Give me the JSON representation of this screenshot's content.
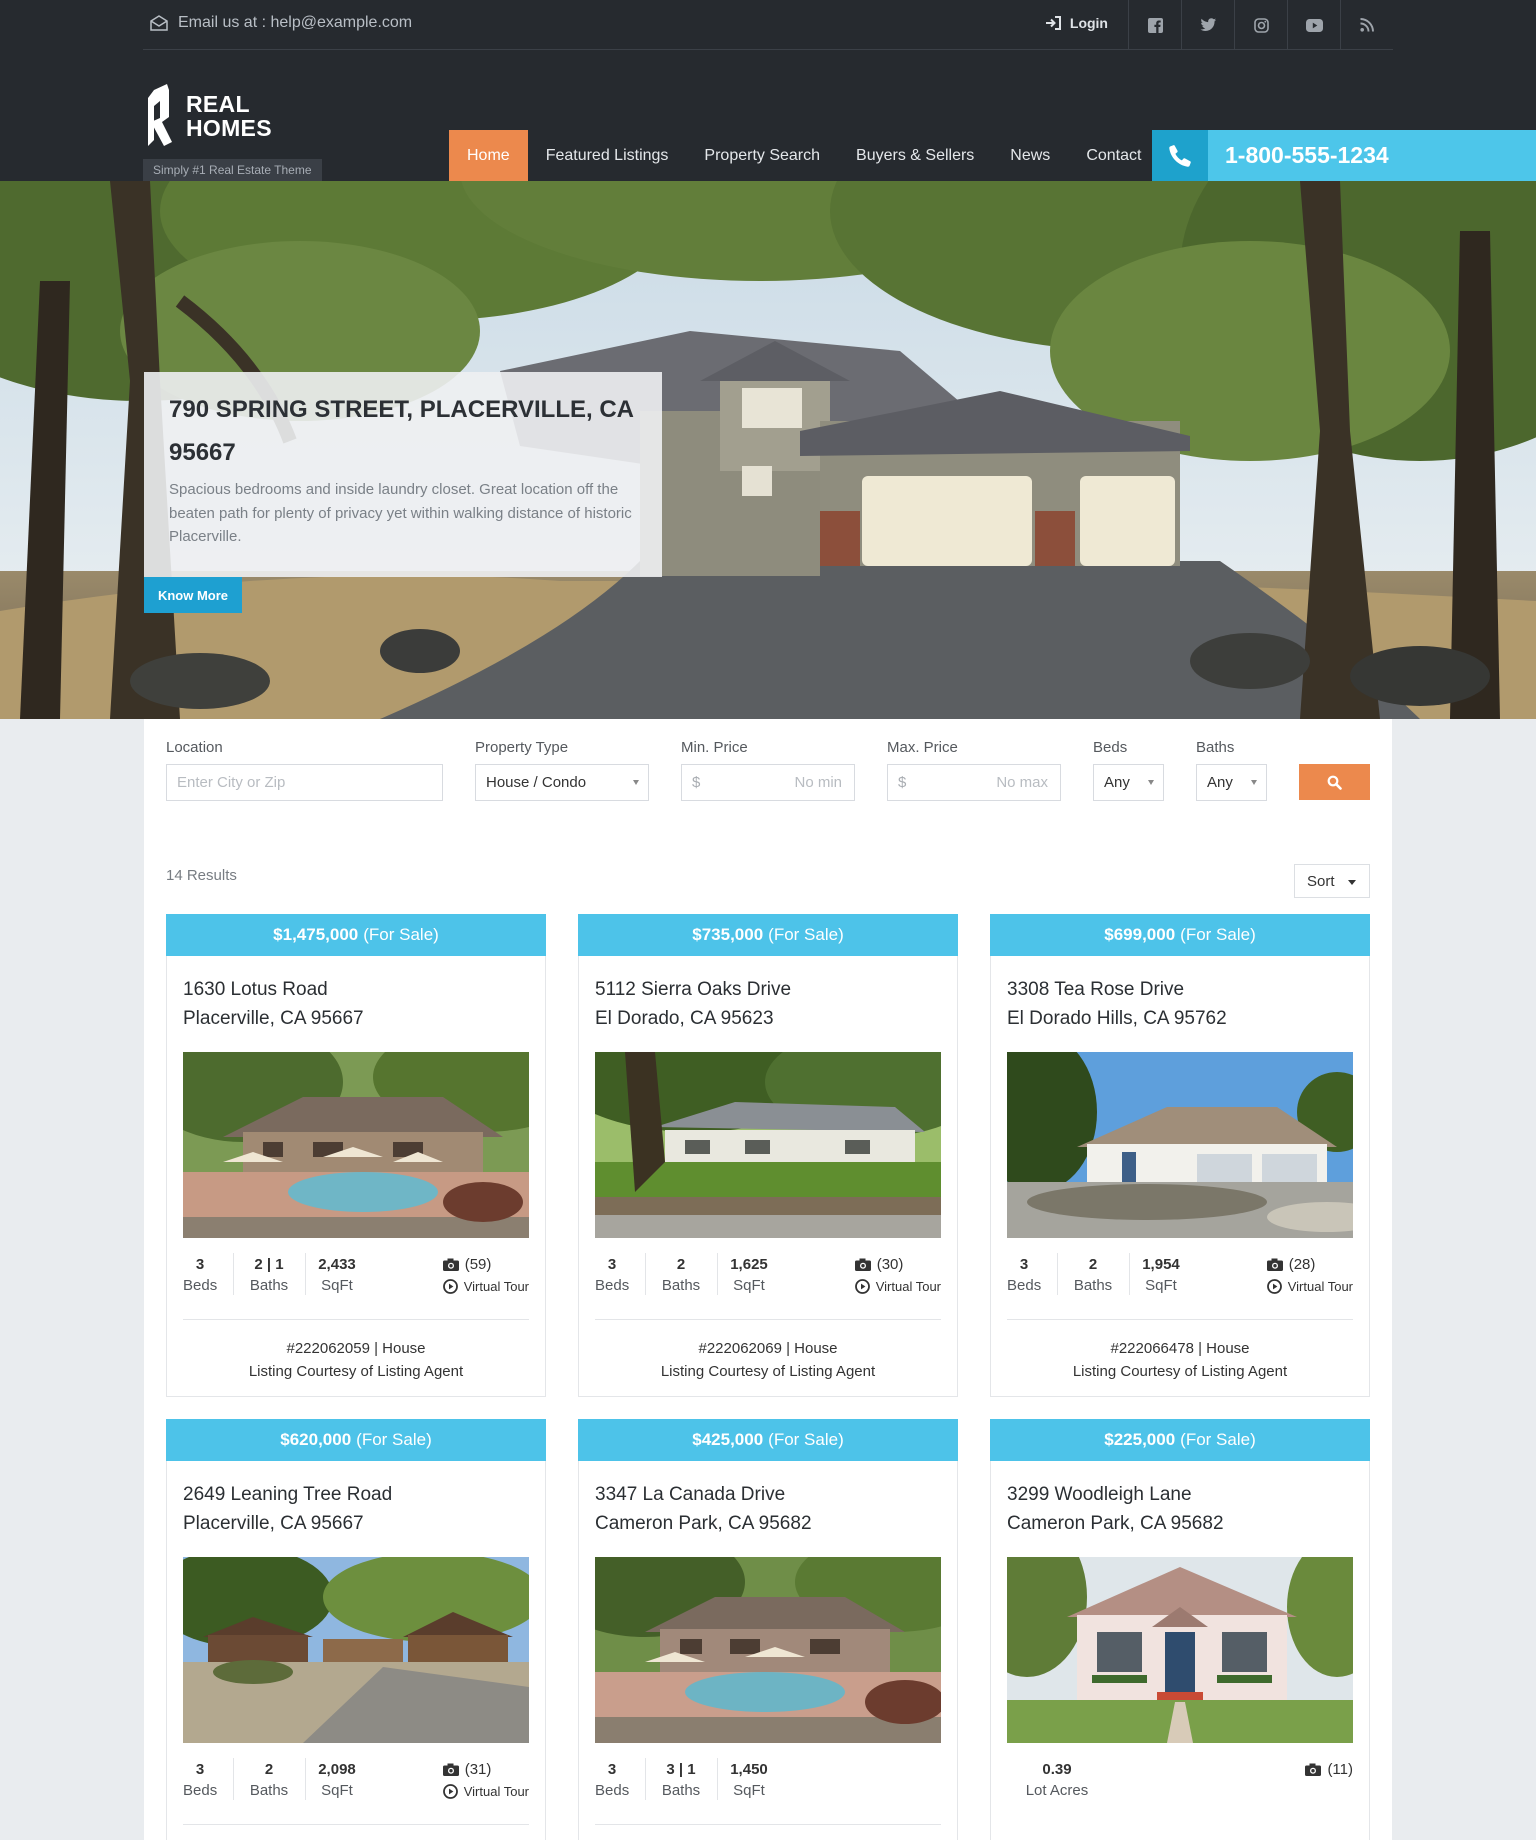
{
  "topbar": {
    "email_text": "Email us at : help@example.com",
    "login_label": "Login",
    "social": [
      "facebook-icon",
      "twitter-icon",
      "instagram-icon",
      "youtube-icon",
      "rss-icon"
    ]
  },
  "brand": {
    "line1": "REAL",
    "line2": "HOMES",
    "tagline": "Simply #1 Real Estate Theme"
  },
  "nav": {
    "items": [
      "Home",
      "Featured Listings",
      "Property Search",
      "Buyers & Sellers",
      "News",
      "Contact"
    ],
    "active": "Home"
  },
  "phone": {
    "number": "1-800-555-1234"
  },
  "hero": {
    "title": "790 SPRING STREET, PLACERVILLE, CA 95667",
    "description": "Spacious bedrooms and inside laundry closet. Great location off the beaten path for plenty of privacy yet within walking distance of historic Placerville.",
    "button": "Know More"
  },
  "search": {
    "location_label": "Location",
    "location_placeholder": "Enter City or Zip",
    "type_label": "Property Type",
    "type_value": "House / Condo",
    "min_label": "Min. Price",
    "min_currency": "$",
    "min_placeholder": "No min",
    "max_label": "Max. Price",
    "max_currency": "$",
    "max_placeholder": "No max",
    "beds_label": "Beds",
    "beds_value": "Any",
    "baths_label": "Baths",
    "baths_value": "Any"
  },
  "results": {
    "count_text": "14 Results",
    "sort_label": "Sort"
  },
  "listings": [
    {
      "price": "$1,475,000",
      "status": "(For Sale)",
      "street": "1630 Lotus Road",
      "city": "Placerville, CA 95667",
      "beds": "3",
      "beds_label": "Beds",
      "baths": "2 | 1",
      "baths_label": "Baths",
      "sqft": "2,433",
      "sqft_label": "SqFt",
      "photos": "(59)",
      "tour": "Virtual Tour",
      "id_type": "#222062059 | House",
      "courtesy": "Listing Courtesy of Listing Agent"
    },
    {
      "price": "$735,000",
      "status": "(For Sale)",
      "street": "5112 Sierra Oaks Drive",
      "city": "El Dorado, CA 95623",
      "beds": "3",
      "beds_label": "Beds",
      "baths": "2",
      "baths_label": "Baths",
      "sqft": "1,625",
      "sqft_label": "SqFt",
      "photos": "(30)",
      "tour": "Virtual Tour",
      "id_type": "#222062069 | House",
      "courtesy": "Listing Courtesy of Listing Agent"
    },
    {
      "price": "$699,000",
      "status": "(For Sale)",
      "street": "3308 Tea Rose Drive",
      "city": "El Dorado Hills, CA 95762",
      "beds": "3",
      "beds_label": "Beds",
      "baths": "2",
      "baths_label": "Baths",
      "sqft": "1,954",
      "sqft_label": "SqFt",
      "photos": "(28)",
      "tour": "Virtual Tour",
      "id_type": "#222066478 | House",
      "courtesy": "Listing Courtesy of Listing Agent"
    },
    {
      "price": "$620,000",
      "status": "(For Sale)",
      "street": "2649 Leaning Tree Road",
      "city": "Placerville, CA 95667",
      "beds": "3",
      "beds_label": "Beds",
      "baths": "2",
      "baths_label": "Baths",
      "sqft": "2,098",
      "sqft_label": "SqFt",
      "photos": "(31)",
      "tour": "Virtual Tour"
    },
    {
      "price": "$425,000",
      "status": "(For Sale)",
      "street": "3347 La Canada Drive",
      "city": "Cameron Park, CA 95682",
      "beds": "3",
      "beds_label": "Beds",
      "baths": "3 | 1",
      "baths_label": "Baths",
      "sqft": "1,450",
      "sqft_label": "SqFt"
    },
    {
      "price": "$225,000",
      "status": "(For Sale)",
      "street": "3299 Woodleigh Lane",
      "city": "Cameron Park, CA 95682",
      "lot": "0.39",
      "lot_label": "Lot Acres",
      "photos": "(11)"
    }
  ],
  "colors": {
    "header_bg": "#262a2f",
    "accent_orange": "#ec894d",
    "accent_blue": "#4dc3e9",
    "button_blue": "#1ea0d1"
  }
}
